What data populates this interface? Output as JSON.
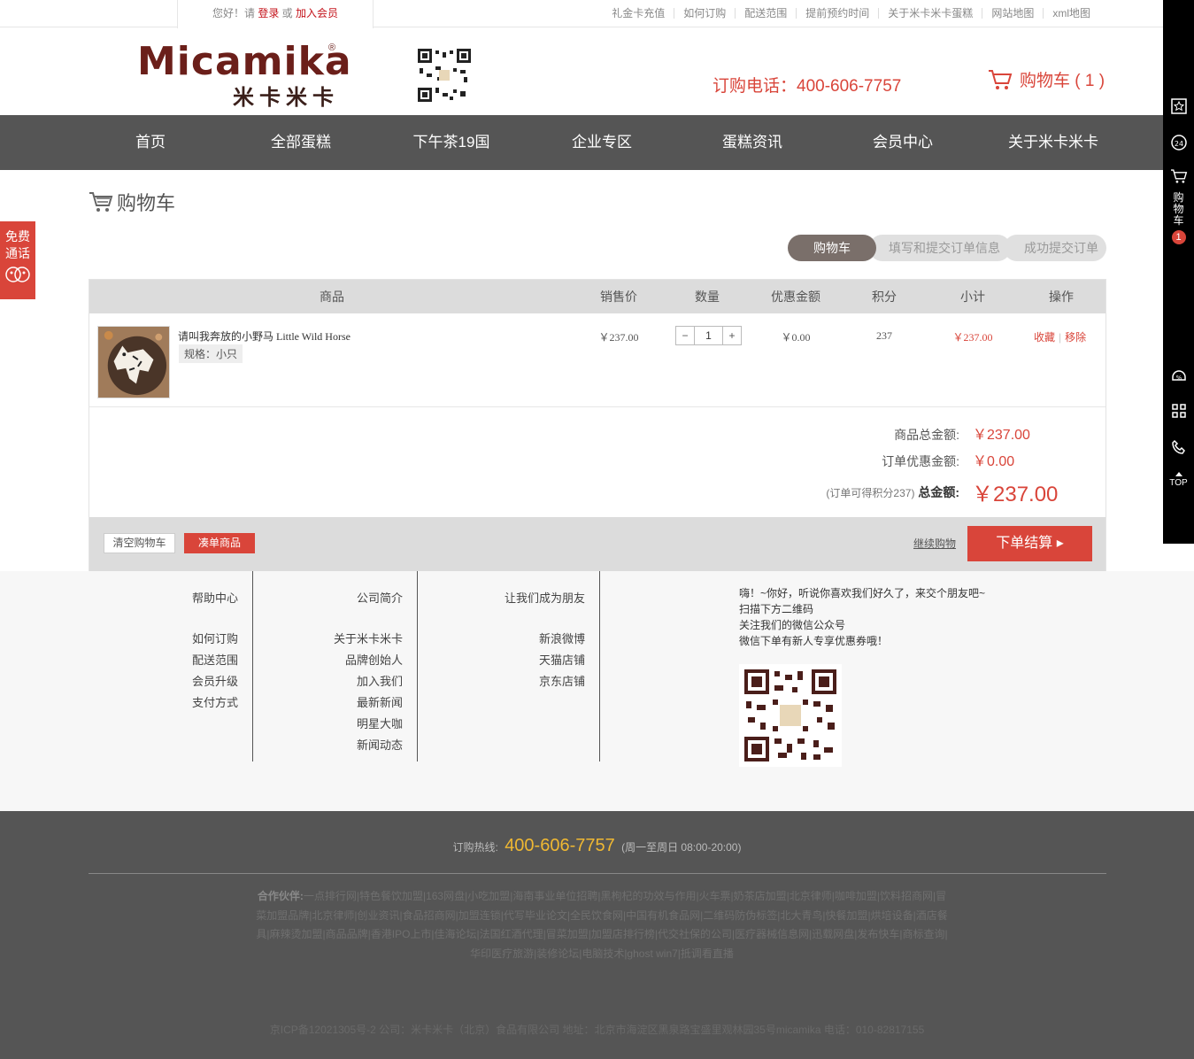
{
  "topbar": {
    "greeting": "您好！请",
    "login": "登录",
    "or": "或",
    "join": "加入会员",
    "links": [
      "礼金卡充值",
      "如何订购",
      "配送范围",
      "提前预约时间",
      "关于米卡米卡蛋糕",
      "网站地图",
      "xml地图"
    ]
  },
  "header": {
    "logo_en": "Micamika",
    "logo_reg": "®",
    "logo_cn": "米卡米卡",
    "phone_label": "订购电话：400-606-7757",
    "cart_label": "购物车 ( 1 )"
  },
  "nav": [
    "首页",
    "全部蛋糕",
    "下午茶19国",
    "企业专区",
    "蛋糕资讯",
    "会员中心",
    "关于米卡米卡"
  ],
  "sidebar": {
    "cart_text": [
      "购",
      "物",
      "车"
    ],
    "cart_count": "1",
    "top": "TOP"
  },
  "freecall": [
    "免费",
    "通话"
  ],
  "page_title": "购物车",
  "steps": [
    "购物车",
    "填写和提交订单信息",
    "成功提交订单"
  ],
  "table": {
    "headers": [
      "商品",
      "销售价",
      "数量",
      "优惠金额",
      "积分",
      "小计",
      "操作"
    ],
    "item": {
      "name": "请叫我奔放的小野马 Little Wild Horse",
      "spec": "规格：小只",
      "price": "￥237.00",
      "qty": "1",
      "qty_minus": "−",
      "qty_plus": "+",
      "discount": "￥0.00",
      "points": "237",
      "subtotal": "￥237.00",
      "fav": "收藏",
      "sep": "|",
      "remove": "移除"
    }
  },
  "summary": {
    "goods_label": "商品总金额:",
    "goods_value": "￥237.00",
    "discount_label": "订单优惠金额:",
    "discount_value": "￥0.00",
    "points_note": "(订单可得积分237)",
    "total_label": "总金额:",
    "total_value": "￥237.00"
  },
  "actions": {
    "clear": "清空购物车",
    "add": "凑单商品",
    "continue": "继续购物",
    "checkout": "下单结算 ▸"
  },
  "footer": {
    "col1": {
      "title": "帮助中心",
      "links": [
        "如何订购",
        "配送范围",
        "会员升级",
        "支付方式"
      ]
    },
    "col2": {
      "title": "公司简介",
      "links": [
        "关于米卡米卡",
        "品牌创始人",
        "加入我们",
        "最新新闻",
        "明星大咖",
        "新闻动态"
      ]
    },
    "col3": {
      "title": "让我们成为朋友",
      "links": [
        "新浪微博",
        "天猫店铺",
        "京东店铺"
      ]
    },
    "friend_lines": [
      "嗨！~你好，听说你喜欢我们好久了，来交个朋友吧~",
      "扫描下方二维码",
      "关注我们的微信公众号",
      "微信下单有新人专享优惠券哦！"
    ]
  },
  "dark_footer": {
    "hotline_label": "订购热线:",
    "hotline_number": "400-606-7757",
    "hotline_hours": "(周一至周日 08:00-20:00)",
    "partners_label": "合作伙伴:",
    "partners": "一点排行网|特色餐饮加盟|163网盘|小吃加盟|海南事业单位招聘|黑枸杞的功效与作用|火车票|奶茶店加盟|北京律师|咖啡加盟|饮料招商网|冒菜加盟品牌|北京律师|创业资讯|食品招商网|加盟连锁|代写毕业论文|全民饮食网|中国有机食品网|二维码防伪标签|北大青鸟|快餐加盟|烘培设备|酒店餐具|麻辣烫加盟|商品品牌|香港IPO上市|佳海论坛|法国红酒代理|冒菜加盟|加盟店排行榜|代交社保的公司|医疗器械信息网|迅载网盘|发布快车|商标查询|华印医疗旅游|装修论坛|电脑技术|ghost win7|抵调看直播",
    "icp": "京ICP备12021305号-2 公司：米卡米卡（北京）食品有限公司 地址：北京市海淀区黑泉路宝盛里观林园35号micamika 电话：010-82817155"
  },
  "colors": {
    "accent": "#d9453a",
    "nav_bg": "#555555",
    "hotline": "#f0b832",
    "brand": "#6b1f1a"
  }
}
